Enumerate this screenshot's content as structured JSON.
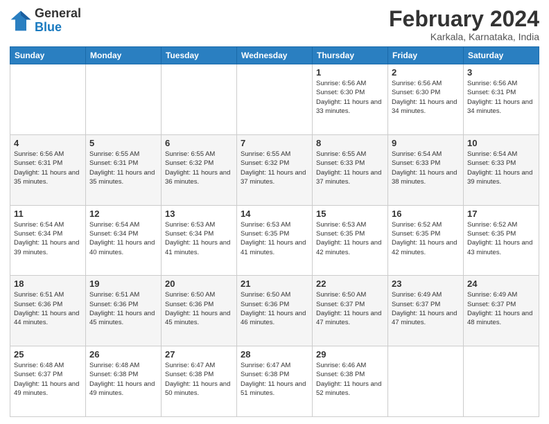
{
  "header": {
    "logo_general": "General",
    "logo_blue": "Blue",
    "month_title": "February 2024",
    "location": "Karkala, Karnataka, India"
  },
  "days_of_week": [
    "Sunday",
    "Monday",
    "Tuesday",
    "Wednesday",
    "Thursday",
    "Friday",
    "Saturday"
  ],
  "weeks": [
    [
      {
        "num": "",
        "info": ""
      },
      {
        "num": "",
        "info": ""
      },
      {
        "num": "",
        "info": ""
      },
      {
        "num": "",
        "info": ""
      },
      {
        "num": "1",
        "info": "Sunrise: 6:56 AM\nSunset: 6:30 PM\nDaylight: 11 hours and 33 minutes."
      },
      {
        "num": "2",
        "info": "Sunrise: 6:56 AM\nSunset: 6:30 PM\nDaylight: 11 hours and 34 minutes."
      },
      {
        "num": "3",
        "info": "Sunrise: 6:56 AM\nSunset: 6:31 PM\nDaylight: 11 hours and 34 minutes."
      }
    ],
    [
      {
        "num": "4",
        "info": "Sunrise: 6:56 AM\nSunset: 6:31 PM\nDaylight: 11 hours and 35 minutes."
      },
      {
        "num": "5",
        "info": "Sunrise: 6:55 AM\nSunset: 6:31 PM\nDaylight: 11 hours and 35 minutes."
      },
      {
        "num": "6",
        "info": "Sunrise: 6:55 AM\nSunset: 6:32 PM\nDaylight: 11 hours and 36 minutes."
      },
      {
        "num": "7",
        "info": "Sunrise: 6:55 AM\nSunset: 6:32 PM\nDaylight: 11 hours and 37 minutes."
      },
      {
        "num": "8",
        "info": "Sunrise: 6:55 AM\nSunset: 6:33 PM\nDaylight: 11 hours and 37 minutes."
      },
      {
        "num": "9",
        "info": "Sunrise: 6:54 AM\nSunset: 6:33 PM\nDaylight: 11 hours and 38 minutes."
      },
      {
        "num": "10",
        "info": "Sunrise: 6:54 AM\nSunset: 6:33 PM\nDaylight: 11 hours and 39 minutes."
      }
    ],
    [
      {
        "num": "11",
        "info": "Sunrise: 6:54 AM\nSunset: 6:34 PM\nDaylight: 11 hours and 39 minutes."
      },
      {
        "num": "12",
        "info": "Sunrise: 6:54 AM\nSunset: 6:34 PM\nDaylight: 11 hours and 40 minutes."
      },
      {
        "num": "13",
        "info": "Sunrise: 6:53 AM\nSunset: 6:34 PM\nDaylight: 11 hours and 41 minutes."
      },
      {
        "num": "14",
        "info": "Sunrise: 6:53 AM\nSunset: 6:35 PM\nDaylight: 11 hours and 41 minutes."
      },
      {
        "num": "15",
        "info": "Sunrise: 6:53 AM\nSunset: 6:35 PM\nDaylight: 11 hours and 42 minutes."
      },
      {
        "num": "16",
        "info": "Sunrise: 6:52 AM\nSunset: 6:35 PM\nDaylight: 11 hours and 42 minutes."
      },
      {
        "num": "17",
        "info": "Sunrise: 6:52 AM\nSunset: 6:35 PM\nDaylight: 11 hours and 43 minutes."
      }
    ],
    [
      {
        "num": "18",
        "info": "Sunrise: 6:51 AM\nSunset: 6:36 PM\nDaylight: 11 hours and 44 minutes."
      },
      {
        "num": "19",
        "info": "Sunrise: 6:51 AM\nSunset: 6:36 PM\nDaylight: 11 hours and 45 minutes."
      },
      {
        "num": "20",
        "info": "Sunrise: 6:50 AM\nSunset: 6:36 PM\nDaylight: 11 hours and 45 minutes."
      },
      {
        "num": "21",
        "info": "Sunrise: 6:50 AM\nSunset: 6:36 PM\nDaylight: 11 hours and 46 minutes."
      },
      {
        "num": "22",
        "info": "Sunrise: 6:50 AM\nSunset: 6:37 PM\nDaylight: 11 hours and 47 minutes."
      },
      {
        "num": "23",
        "info": "Sunrise: 6:49 AM\nSunset: 6:37 PM\nDaylight: 11 hours and 47 minutes."
      },
      {
        "num": "24",
        "info": "Sunrise: 6:49 AM\nSunset: 6:37 PM\nDaylight: 11 hours and 48 minutes."
      }
    ],
    [
      {
        "num": "25",
        "info": "Sunrise: 6:48 AM\nSunset: 6:37 PM\nDaylight: 11 hours and 49 minutes."
      },
      {
        "num": "26",
        "info": "Sunrise: 6:48 AM\nSunset: 6:38 PM\nDaylight: 11 hours and 49 minutes."
      },
      {
        "num": "27",
        "info": "Sunrise: 6:47 AM\nSunset: 6:38 PM\nDaylight: 11 hours and 50 minutes."
      },
      {
        "num": "28",
        "info": "Sunrise: 6:47 AM\nSunset: 6:38 PM\nDaylight: 11 hours and 51 minutes."
      },
      {
        "num": "29",
        "info": "Sunrise: 6:46 AM\nSunset: 6:38 PM\nDaylight: 11 hours and 52 minutes."
      },
      {
        "num": "",
        "info": ""
      },
      {
        "num": "",
        "info": ""
      }
    ]
  ]
}
